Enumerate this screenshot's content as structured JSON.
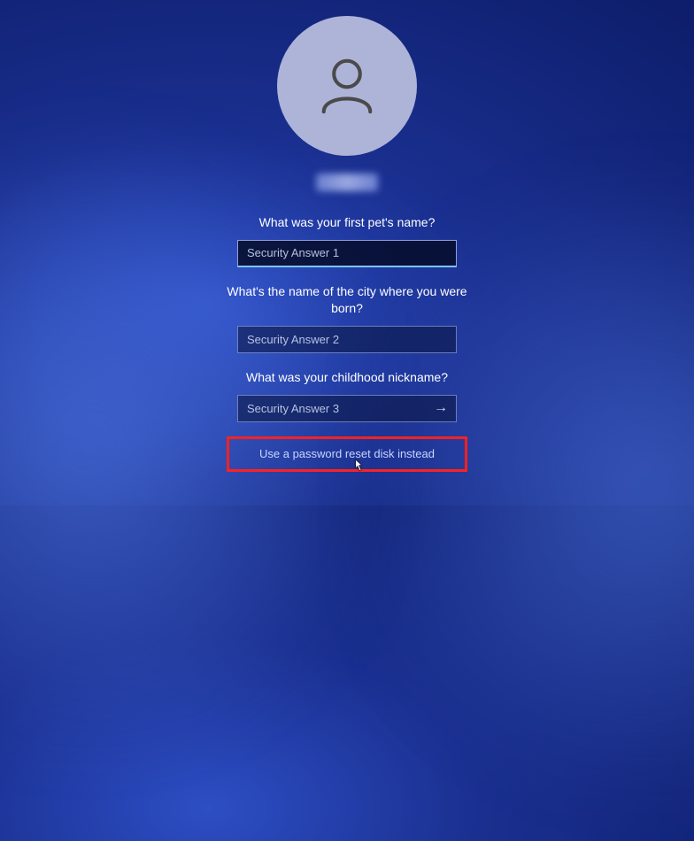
{
  "questions": {
    "q1": "What was your first pet's name?",
    "q2": "What's the name of the city where you were born?",
    "q3": "What was your childhood nickname?"
  },
  "placeholders": {
    "a1": "Security Answer 1",
    "a2": "Security Answer 2",
    "a3": "Security Answer 3"
  },
  "altLink": "Use a password reset disk instead",
  "submitGlyph": "→"
}
